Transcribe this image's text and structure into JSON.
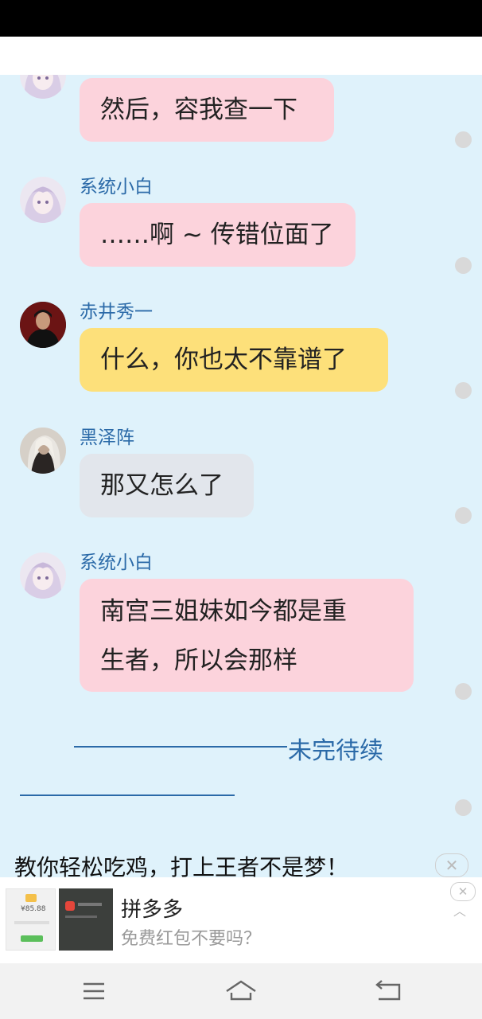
{
  "chat": {
    "messages": [
      {
        "sender": "",
        "text": "然后，容我查一下"
      },
      {
        "sender": "系统小白",
        "text": "……啊 ~ 传错位面了"
      },
      {
        "sender": "赤井秀一",
        "text": "什么，你也太不靠谱了"
      },
      {
        "sender": "黑泽阵",
        "text": "那又怎么了"
      },
      {
        "sender": "系统小白",
        "text_line1": "南宫三姐妹如今都是重",
        "text_line2": "生者，所以会那样"
      }
    ],
    "to_be_continued": "未完待续"
  },
  "ad": {
    "title": "教你轻松吃鸡，打上王者不是梦！",
    "app_name": "拼多多",
    "description": "免费红包不要吗？",
    "close_symbol": "✕",
    "collapse_symbol": "︿",
    "price_text": "¥85.88"
  },
  "colors": {
    "chat_background": "#dff2fb",
    "bubble_pink": "#fcd3dc",
    "bubble_yellow": "#fde07a",
    "bubble_grey": "#e2e6ec",
    "name_blue": "#2b6aa8"
  },
  "icons": {
    "nav_menu": "menu-icon",
    "nav_home": "home-icon",
    "nav_back": "back-icon"
  }
}
